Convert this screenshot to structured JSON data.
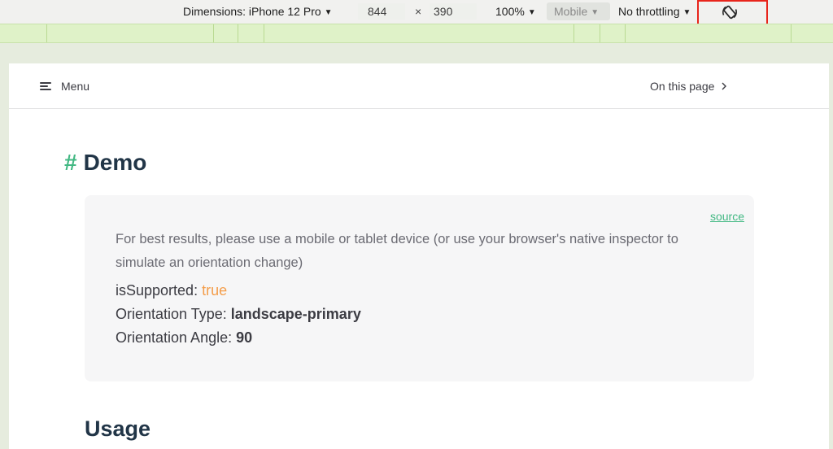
{
  "toolbar": {
    "dimensions_label": "Dimensions: iPhone 12 Pro",
    "width": "844",
    "times": "×",
    "height": "390",
    "zoom": "100%",
    "device_type": "Mobile",
    "throttling": "No throttling",
    "rotate_icon": "rotate-icon"
  },
  "navbar": {
    "menu_label": "Menu",
    "on_this_page": "On this page"
  },
  "content": {
    "heading_hash": "#",
    "heading": "Demo",
    "source_link": "source",
    "note": "For best results, please use a mobile or tablet device (or use your browser's native inspector to simulate an orientation change)",
    "is_supported_label": "isSupported:",
    "is_supported_value": "true",
    "orientation_type_label": "Orientation Type:",
    "orientation_type_value": "landscape-primary",
    "orientation_angle_label": "Orientation Angle:",
    "orientation_angle_value": "90",
    "usage_heading": "Usage"
  },
  "colors": {
    "accent": "#42b883",
    "highlight": "#e8251b",
    "value_orange": "#f49d4a"
  }
}
